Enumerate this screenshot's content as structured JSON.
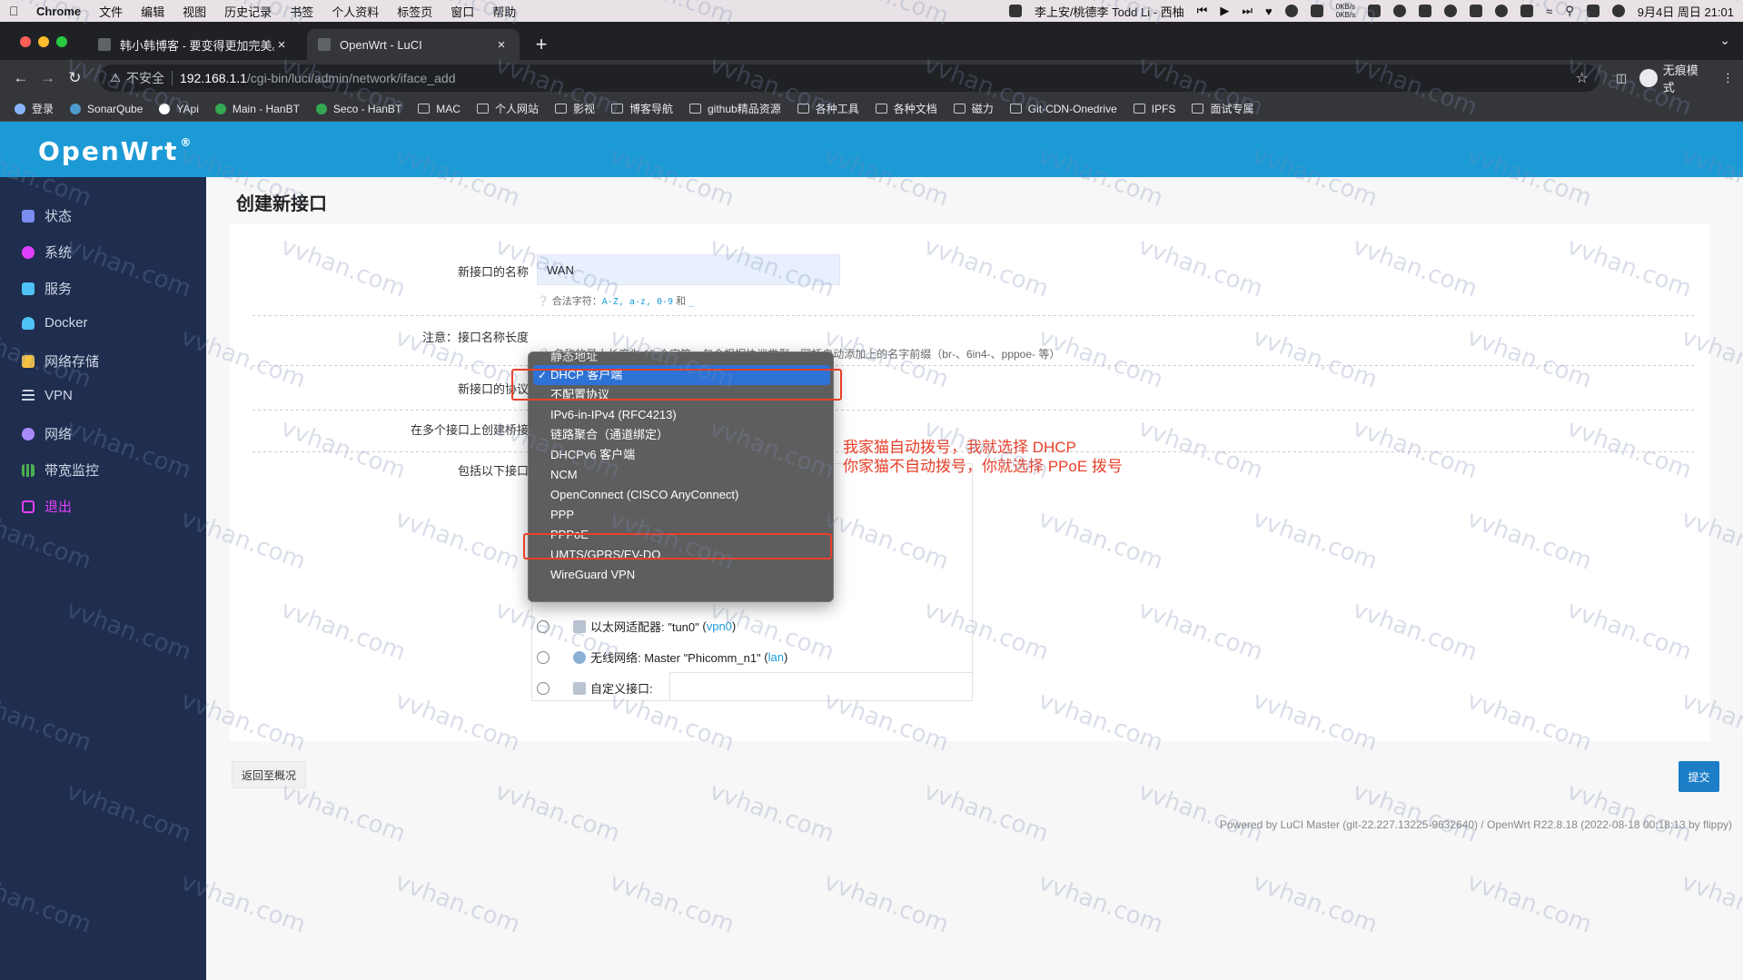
{
  "menubar": {
    "app": "Chrome",
    "items": [
      "文件",
      "编辑",
      "视图",
      "历史记录",
      "书签",
      "个人资料",
      "标签页",
      "窗口",
      "帮助"
    ],
    "now_playing": "李上安/桃德李 Todd Li - 西柚",
    "net_speed_up": "0KB/s",
    "net_speed_down": "0KB/s",
    "clock": "9月4日 周日 21:01"
  },
  "tabs": [
    {
      "title": "韩小韩博客 - 要变得更加完美。",
      "active": false
    },
    {
      "title": "OpenWrt - LuCI",
      "active": true
    }
  ],
  "address": {
    "insecure_label": "不安全",
    "host": "192.168.1.1",
    "path": "/cgi-bin/luci/admin/network/iface_add",
    "incognito_label": "无痕模式"
  },
  "bookmarks": [
    "登录",
    "SonarQube",
    "YApi",
    "Main - HanBT",
    "Seco - HanBT",
    "MAC",
    "个人网站",
    "影视",
    "博客导航",
    "github精品资源",
    "各种工具",
    "各种文档",
    "磁力",
    "Git-CDN-Onedrive",
    "IPFS",
    "面试专属"
  ],
  "brand": "OpenWrt",
  "brand_mark": "®",
  "sidebar": {
    "items": [
      {
        "label": "状态",
        "icon": "home-icon",
        "color": "#7b8cf0"
      },
      {
        "label": "系统",
        "icon": "gear-icon",
        "color": "#e040fb"
      },
      {
        "label": "服务",
        "icon": "download-icon",
        "color": "#4fc3f7"
      },
      {
        "label": "Docker",
        "icon": "docker-icon",
        "color": "#4fc3f7"
      },
      {
        "label": "网络存储",
        "icon": "storage-icon",
        "color": "#f6c342"
      },
      {
        "label": "VPN",
        "icon": "list-icon",
        "color": "#cfd6e4"
      },
      {
        "label": "网络",
        "icon": "globe-icon",
        "color": "#a78bfa"
      },
      {
        "label": "带宽监控",
        "icon": "bar-chart-icon",
        "color": "#4caf50"
      },
      {
        "label": "退出",
        "icon": "logout-icon",
        "color": "#e040fb"
      }
    ]
  },
  "page": {
    "title": "创建新接口",
    "name_label": "新接口的名称",
    "name_value": "WAN",
    "hint_prefix": "合法字符：",
    "hint_chars": "A-Z, a-z, 0-9",
    "hint_and": "和",
    "hint_underscore": "_",
    "note_label": "注意：接口名称长度",
    "note_text": "名称的最大长度为 15 个字符，包含根据协议类型，网桥自动添加上的名字前缀（br-、6in4-、pppoe- 等）",
    "protocol_label": "新接口的协议",
    "bridge_label": "在多个接口上创建桥接",
    "include_label": "包括以下接口",
    "interfaces": [
      {
        "label": "以太网适配器: \"tun0\"",
        "net": "vpn0"
      },
      {
        "label": "无线网络: Master \"Phicomm_n1\"",
        "net": "lan"
      },
      {
        "label": "自定义接口:",
        "net": ""
      }
    ],
    "back_button": "返回至概况",
    "submit_button": "提交",
    "footer": "Powered by LuCI Master (git-22.227.13225-9632640) / OpenWrt R22.8.18 (2022-08-18 00:18:13 by flippy)"
  },
  "dropdown": {
    "options": [
      "静态地址",
      "DHCP 客户端",
      "不配置协议",
      "IPv6-in-IPv4 (RFC4213)",
      "链路聚合（通道绑定）",
      "DHCPv6 客户端",
      "NCM",
      "OpenConnect (CISCO AnyConnect)",
      "PPP",
      "PPPoE",
      "UMTS/GPRS/EV-DO",
      "WireGuard VPN"
    ],
    "selected": "DHCP 客户端"
  },
  "annotation": {
    "line1": "我家猫自动拨号，我就选择 DHCP",
    "line2": "你家猫不自动拨号，你就选择 PPoE 拨号",
    "color": "#e8402a"
  },
  "watermark": "vvhan.com"
}
